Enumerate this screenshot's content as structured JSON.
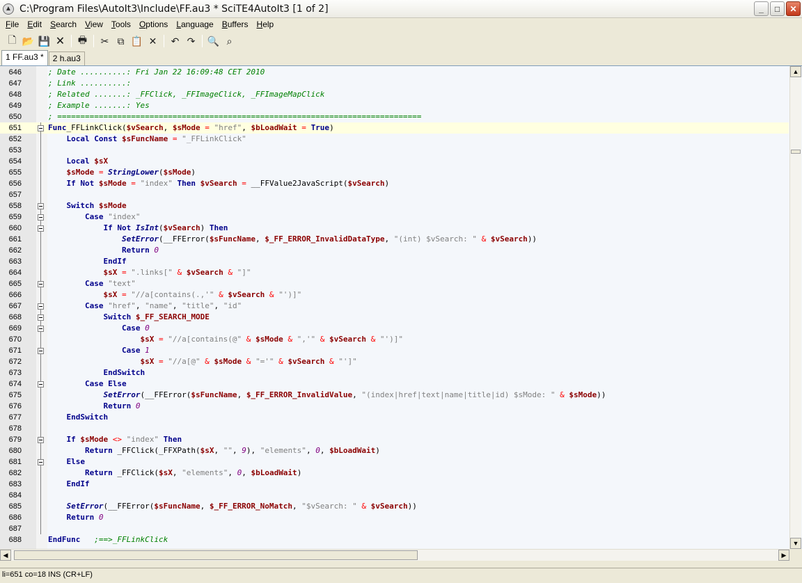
{
  "window": {
    "title": "C:\\Program Files\\AutoIt3\\Include\\FF.au3 * SciTE4AutoIt3 [1 of 2]"
  },
  "menu": [
    {
      "label": "File",
      "u": "F",
      "rest": "ile"
    },
    {
      "label": "Edit",
      "u": "E",
      "rest": "dit"
    },
    {
      "label": "Search",
      "u": "S",
      "rest": "earch"
    },
    {
      "label": "View",
      "u": "V",
      "rest": "iew"
    },
    {
      "label": "Tools",
      "u": "T",
      "rest": "ools"
    },
    {
      "label": "Options",
      "u": "O",
      "rest": "ptions"
    },
    {
      "label": "Language",
      "u": "L",
      "rest": "anguage"
    },
    {
      "label": "Buffers",
      "u": "B",
      "rest": "uffers"
    },
    {
      "label": "Help",
      "u": "H",
      "rest": "elp"
    }
  ],
  "tabs": [
    {
      "label": "1 FF.au3 *",
      "active": true
    },
    {
      "label": "2 h.au3",
      "active": false
    }
  ],
  "toolbar": [
    "new-file-icon",
    "open-folder-icon",
    "save-icon",
    "close-file-icon",
    "print-icon",
    "cut-icon",
    "copy-icon",
    "paste-icon",
    "delete-icon",
    "undo-icon",
    "redo-icon",
    "find-icon",
    "find-replace-icon"
  ],
  "status": "li=651 co=18 INS (CR+LF)",
  "colors": {
    "comment": "#008000",
    "keyword": "#00008b",
    "variable": "#8b0000",
    "string": "#808080",
    "number": "#800080"
  },
  "lines": [
    {
      "n": "646",
      "t": [
        [
          "cm",
          "; Date ..........: Fri Jan 22 16:09:48 CET 2010"
        ]
      ]
    },
    {
      "n": "647",
      "t": [
        [
          "cm",
          "; Link ..........:"
        ]
      ]
    },
    {
      "n": "648",
      "t": [
        [
          "cm",
          "; Related .......: _FFClick, _FFImageClick, _FFImageMapClick"
        ]
      ]
    },
    {
      "n": "649",
      "t": [
        [
          "cm",
          "; Example .......: Yes"
        ]
      ]
    },
    {
      "n": "650",
      "t": [
        [
          "cm",
          "; ==============================================================================="
        ]
      ]
    },
    {
      "n": "651",
      "t": [
        [
          "kw",
          "Func"
        ],
        [
          "",
          "_FFLinkClick("
        ],
        [
          "vr",
          "$vSearch"
        ],
        [
          "",
          ", "
        ],
        [
          "vr",
          "$sMode"
        ],
        [
          "",
          ""
        ],
        [
          "op",
          " = "
        ],
        [
          "st",
          "\"href\""
        ],
        [
          "",
          ", "
        ],
        [
          "vr",
          "$bLoadWait"
        ],
        [
          "op",
          " = "
        ],
        [
          "kw",
          "True"
        ],
        [
          "",
          ")"
        ]
      ]
    },
    {
      "n": "652",
      "t": [
        [
          "",
          "    "
        ],
        [
          "kw",
          "Local Const"
        ],
        [
          "",
          ""
        ],
        [
          "vr",
          " $sFuncName"
        ],
        [
          "op",
          " = "
        ],
        [
          "st",
          "\"_FFLinkClick\""
        ]
      ]
    },
    {
      "n": "653",
      "t": []
    },
    {
      "n": "654",
      "t": [
        [
          "",
          "    "
        ],
        [
          "kw",
          "Local"
        ],
        [
          "vr",
          " $sX"
        ]
      ]
    },
    {
      "n": "655",
      "t": [
        [
          "",
          "    "
        ],
        [
          "vr",
          "$sMode"
        ],
        [
          "op",
          " = "
        ],
        [
          "fn",
          "StringLower"
        ],
        [
          "",
          "("
        ],
        [
          "vr",
          "$sMode"
        ],
        [
          "",
          ")"
        ]
      ]
    },
    {
      "n": "656",
      "t": [
        [
          "",
          "    "
        ],
        [
          "kw",
          "If Not"
        ],
        [
          "vr",
          " $sMode"
        ],
        [
          "op",
          " = "
        ],
        [
          "st",
          "\"index\""
        ],
        [
          "kw",
          " Then"
        ],
        [
          "vr",
          " $vSearch"
        ],
        [
          "op",
          " = "
        ],
        [
          "",
          "__FFValue2JavaScript("
        ],
        [
          "vr",
          "$vSearch"
        ],
        [
          "",
          ")"
        ]
      ]
    },
    {
      "n": "657",
      "t": []
    },
    {
      "n": "658",
      "t": [
        [
          "",
          "    "
        ],
        [
          "kw",
          "Switch"
        ],
        [
          "vr",
          " $sMode"
        ]
      ]
    },
    {
      "n": "659",
      "t": [
        [
          "",
          "        "
        ],
        [
          "kw",
          "Case"
        ],
        [
          "st",
          " \"index\""
        ]
      ]
    },
    {
      "n": "660",
      "t": [
        [
          "",
          "            "
        ],
        [
          "kw",
          "If Not"
        ],
        [
          "fn",
          " IsInt"
        ],
        [
          "",
          "("
        ],
        [
          "vr",
          "$vSearch"
        ],
        [
          "",
          ")"
        ],
        [
          "kw",
          " Then"
        ]
      ]
    },
    {
      "n": "661",
      "t": [
        [
          "",
          "                "
        ],
        [
          "fn",
          "SetError"
        ],
        [
          "",
          "(__FFError("
        ],
        [
          "vr",
          "$sFuncName"
        ],
        [
          "",
          ", "
        ],
        [
          "vr",
          "$_FF_ERROR_InvalidDataType"
        ],
        [
          "",
          ", "
        ],
        [
          "st",
          "\"(int) $vSearch: \""
        ],
        [
          "op",
          " & "
        ],
        [
          "vr",
          "$vSearch"
        ],
        [
          "",
          "))"
        ]
      ]
    },
    {
      "n": "662",
      "t": [
        [
          "",
          "                "
        ],
        [
          "kw",
          "Return"
        ],
        [
          "nm",
          " 0"
        ]
      ]
    },
    {
      "n": "663",
      "t": [
        [
          "",
          "            "
        ],
        [
          "kw",
          "EndIf"
        ]
      ]
    },
    {
      "n": "664",
      "t": [
        [
          "",
          "            "
        ],
        [
          "vr",
          "$sX"
        ],
        [
          "op",
          " = "
        ],
        [
          "st",
          "\".links[\""
        ],
        [
          "op",
          " & "
        ],
        [
          "vr",
          "$vSearch"
        ],
        [
          "op",
          " & "
        ],
        [
          "st",
          "\"]\""
        ]
      ]
    },
    {
      "n": "665",
      "t": [
        [
          "",
          "        "
        ],
        [
          "kw",
          "Case"
        ],
        [
          "st",
          " \"text\""
        ]
      ]
    },
    {
      "n": "666",
      "t": [
        [
          "",
          "            "
        ],
        [
          "vr",
          "$sX"
        ],
        [
          "op",
          " = "
        ],
        [
          "st",
          "\"//a[contains(.,'\""
        ],
        [
          "op",
          " & "
        ],
        [
          "vr",
          "$vSearch"
        ],
        [
          "op",
          " & "
        ],
        [
          "st",
          "\"')]\""
        ]
      ]
    },
    {
      "n": "667",
      "t": [
        [
          "",
          "        "
        ],
        [
          "kw",
          "Case"
        ],
        [
          "st",
          " \"href\""
        ],
        [
          "",
          ", "
        ],
        [
          "st",
          "\"name\""
        ],
        [
          "",
          ", "
        ],
        [
          "st",
          "\"title\""
        ],
        [
          "",
          ", "
        ],
        [
          "st",
          "\"id\""
        ]
      ]
    },
    {
      "n": "668",
      "t": [
        [
          "",
          "            "
        ],
        [
          "kw",
          "Switch"
        ],
        [
          "vr",
          " $_FF_SEARCH_MODE"
        ]
      ]
    },
    {
      "n": "669",
      "t": [
        [
          "",
          "                "
        ],
        [
          "kw",
          "Case"
        ],
        [
          "nm",
          " 0"
        ]
      ]
    },
    {
      "n": "670",
      "t": [
        [
          "",
          "                    "
        ],
        [
          "vr",
          "$sX"
        ],
        [
          "op",
          " = "
        ],
        [
          "st",
          "\"//a[contains(@\""
        ],
        [
          "op",
          " & "
        ],
        [
          "vr",
          "$sMode"
        ],
        [
          "op",
          " & "
        ],
        [
          "st",
          "\",'\""
        ],
        [
          "op",
          " & "
        ],
        [
          "vr",
          "$vSearch"
        ],
        [
          "op",
          " & "
        ],
        [
          "st",
          "\"')]\""
        ]
      ]
    },
    {
      "n": "671",
      "t": [
        [
          "",
          "                "
        ],
        [
          "kw",
          "Case"
        ],
        [
          "nm",
          " 1"
        ]
      ]
    },
    {
      "n": "672",
      "t": [
        [
          "",
          "                    "
        ],
        [
          "vr",
          "$sX"
        ],
        [
          "op",
          " = "
        ],
        [
          "st",
          "\"//a[@\""
        ],
        [
          "op",
          " & "
        ],
        [
          "vr",
          "$sMode"
        ],
        [
          "op",
          " & "
        ],
        [
          "st",
          "\"='\""
        ],
        [
          "op",
          " & "
        ],
        [
          "vr",
          "$vSearch"
        ],
        [
          "op",
          " & "
        ],
        [
          "st",
          "\"']\""
        ]
      ]
    },
    {
      "n": "673",
      "t": [
        [
          "",
          "            "
        ],
        [
          "kw",
          "EndSwitch"
        ]
      ]
    },
    {
      "n": "674",
      "t": [
        [
          "",
          "        "
        ],
        [
          "kw",
          "Case Else"
        ]
      ]
    },
    {
      "n": "675",
      "t": [
        [
          "",
          "            "
        ],
        [
          "fn",
          "SetError"
        ],
        [
          "",
          "(__FFError("
        ],
        [
          "vr",
          "$sFuncName"
        ],
        [
          "",
          ", "
        ],
        [
          "vr",
          "$_FF_ERROR_InvalidValue"
        ],
        [
          "",
          ", "
        ],
        [
          "st",
          "\"(index|href|text|name|title|id) $sMode: \""
        ],
        [
          "op",
          " & "
        ],
        [
          "vr",
          "$sMode"
        ],
        [
          "",
          "))"
        ]
      ]
    },
    {
      "n": "676",
      "t": [
        [
          "",
          "            "
        ],
        [
          "kw",
          "Return"
        ],
        [
          "nm",
          " 0"
        ]
      ]
    },
    {
      "n": "677",
      "t": [
        [
          "",
          "    "
        ],
        [
          "kw",
          "EndSwitch"
        ]
      ]
    },
    {
      "n": "678",
      "t": []
    },
    {
      "n": "679",
      "t": [
        [
          "",
          "    "
        ],
        [
          "kw",
          "If"
        ],
        [
          "vr",
          " $sMode"
        ],
        [
          "op",
          " <> "
        ],
        [
          "st",
          "\"index\""
        ],
        [
          "kw",
          " Then"
        ]
      ]
    },
    {
      "n": "680",
      "t": [
        [
          "",
          "        "
        ],
        [
          "kw",
          "Return"
        ],
        [
          "",
          " _FFClick(_FFXPath("
        ],
        [
          "vr",
          "$sX"
        ],
        [
          "",
          ", "
        ],
        [
          "st",
          "\"\""
        ],
        [
          "",
          ", "
        ],
        [
          "nm",
          "9"
        ],
        [
          "",
          "), "
        ],
        [
          "st",
          "\"elements\""
        ],
        [
          "",
          ", "
        ],
        [
          "nm",
          "0"
        ],
        [
          "",
          ", "
        ],
        [
          "vr",
          "$bLoadWait"
        ],
        [
          "",
          ")"
        ]
      ]
    },
    {
      "n": "681",
      "t": [
        [
          "",
          "    "
        ],
        [
          "kw",
          "Else"
        ]
      ]
    },
    {
      "n": "682",
      "t": [
        [
          "",
          "        "
        ],
        [
          "kw",
          "Return"
        ],
        [
          "",
          " _FFClick("
        ],
        [
          "vr",
          "$sX"
        ],
        [
          "",
          ", "
        ],
        [
          "st",
          "\"elements\""
        ],
        [
          "",
          ", "
        ],
        [
          "nm",
          "0"
        ],
        [
          "",
          ", "
        ],
        [
          "vr",
          "$bLoadWait"
        ],
        [
          "",
          ")"
        ]
      ]
    },
    {
      "n": "683",
      "t": [
        [
          "",
          "    "
        ],
        [
          "kw",
          "EndIf"
        ]
      ]
    },
    {
      "n": "684",
      "t": []
    },
    {
      "n": "685",
      "t": [
        [
          "",
          "    "
        ],
        [
          "fn",
          "SetError"
        ],
        [
          "",
          "(__FFError("
        ],
        [
          "vr",
          "$sFuncName"
        ],
        [
          "",
          ", "
        ],
        [
          "vr",
          "$_FF_ERROR_NoMatch"
        ],
        [
          "",
          ", "
        ],
        [
          "st",
          "\"$vSearch: \""
        ],
        [
          "op",
          " & "
        ],
        [
          "vr",
          "$vSearch"
        ],
        [
          "",
          "))"
        ]
      ]
    },
    {
      "n": "686",
      "t": [
        [
          "",
          "    "
        ],
        [
          "kw",
          "Return"
        ],
        [
          "nm",
          " 0"
        ]
      ]
    },
    {
      "n": "687",
      "t": []
    },
    {
      "n": "688",
      "t": [
        [
          "kw",
          "EndFunc"
        ],
        [
          "cm",
          "   ;==>_FFLinkClick"
        ]
      ]
    }
  ]
}
